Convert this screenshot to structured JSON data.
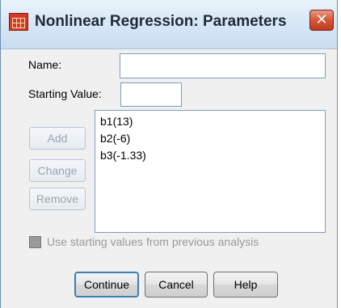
{
  "window": {
    "title": "Nonlinear Regression: Parameters",
    "close_glyph": "✕",
    "icon": "spreadsheet-icon"
  },
  "form": {
    "name_label": "Name:",
    "name_value": "",
    "starting_value_label": "Starting Value:",
    "starting_value_value": ""
  },
  "side_buttons": {
    "add": "Add",
    "change": "Change",
    "remove": "Remove"
  },
  "parameters": [
    "b1(13)",
    "b2(-6)",
    "b3(-1.33)"
  ],
  "checkbox": {
    "label": "Use starting values from previous analysis",
    "checked": false,
    "enabled": false
  },
  "buttons": {
    "continue": "Continue",
    "cancel": "Cancel",
    "help": "Help"
  }
}
